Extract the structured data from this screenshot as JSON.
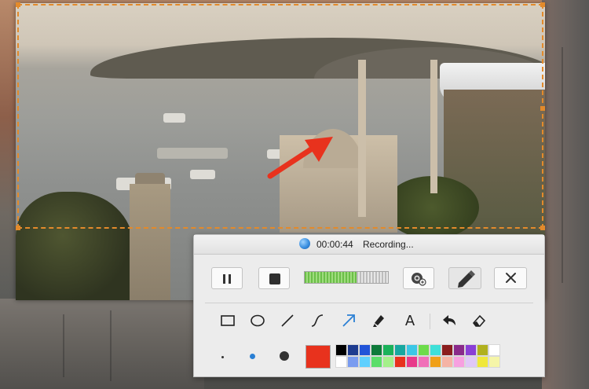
{
  "recorder": {
    "elapsed_time": "00:00:44",
    "status_label": "Recording...",
    "progress_fraction": 0.62,
    "brush_sizes": [
      "small",
      "medium",
      "large"
    ],
    "selected_color": "#e8321d",
    "palette": [
      "#000000",
      "#1d3b8f",
      "#2153d8",
      "#0e7a3a",
      "#1bb25a",
      "#17a8a0",
      "#3cc7e6",
      "#6ddc4a",
      "#3fe0d8",
      "#8a1e1e",
      "#8a2a8a",
      "#8a3fd6",
      "#b0b01e",
      "#ffffff",
      "#ffffff",
      "#7a9cf0",
      "#5fd0ff",
      "#5bde6a",
      "#a4f08a",
      "#e8321d",
      "#e83a8a",
      "#f070b8",
      "#f0a018",
      "#f5b3a5",
      "#f7a0e0",
      "#e0c8f8",
      "#f0e83a",
      "#f5f5a8"
    ]
  },
  "icons": {
    "pause": "pause-icon",
    "stop": "stop-icon",
    "webcam": "webcam-icon",
    "annotate": "pencil-icon",
    "close": "close-icon",
    "rectangle": "rectangle-icon",
    "ellipse": "ellipse-icon",
    "line": "line-icon",
    "curve": "curve-icon",
    "arrow": "arrow-icon",
    "highlighter": "highlighter-icon",
    "text": "A",
    "undo": "undo-icon",
    "eraser": "eraser-icon"
  },
  "colors": {
    "selection_border": "#e38a2b",
    "annotation_arrow": "#e8321d"
  }
}
